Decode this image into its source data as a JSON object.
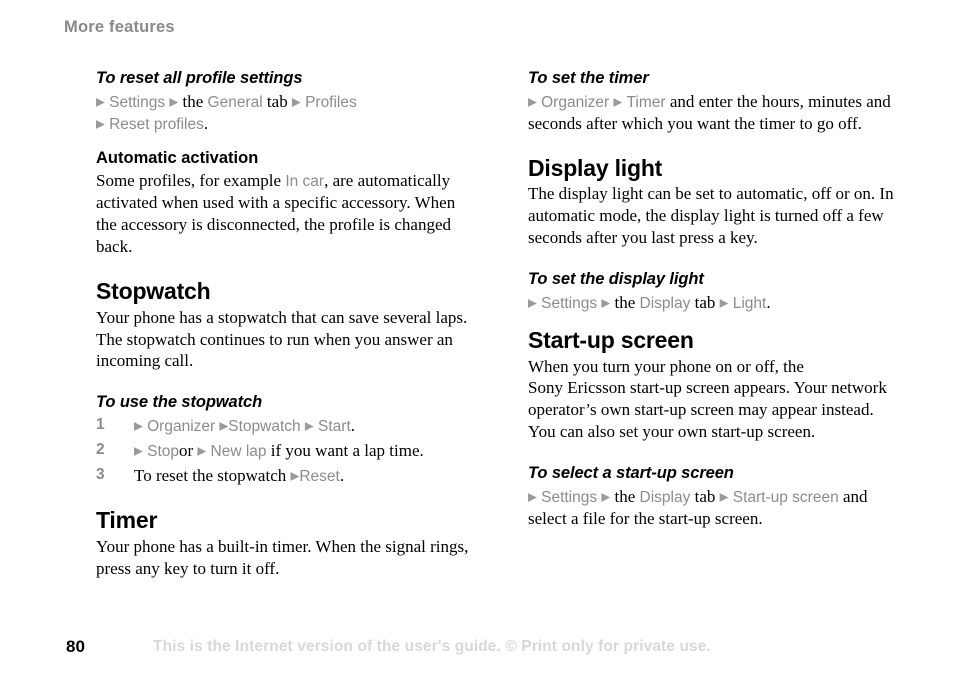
{
  "header": {
    "running_title": "More features"
  },
  "arrow_glyph": "▶",
  "colors": {
    "ui_term_gray": "#8c8c8c",
    "header_gray": "#8a8a8a",
    "watermark_gray": "#d8d8d8",
    "body_black": "#000000"
  },
  "left_column": {
    "proc_reset_profiles": {
      "title": "To reset all profile settings",
      "line1": {
        "term1": "Settings",
        "connector1": "the",
        "term2": "General",
        "connector2": "tab",
        "term3": "Profiles"
      },
      "line2": {
        "term1": "Reset profiles",
        "period": "."
      }
    },
    "automatic_activation": {
      "title": "Automatic activation",
      "text_before": "Some profiles, for example ",
      "ui_term": "In car",
      "text_after": ", are automatically activated when used with a specific accessory. When the accessory is disconnected, the profile is changed back."
    },
    "stopwatch": {
      "title": "Stopwatch",
      "body": "Your phone has a stopwatch that can save several laps. The stopwatch continues to run when you answer an incoming call."
    },
    "proc_use_stopwatch": {
      "title": "To use the stopwatch",
      "steps": [
        {
          "number": "1",
          "term1": "Organizer",
          "term2": "Stopwatch",
          "term3": "Start",
          "period": "."
        },
        {
          "number": "2",
          "term1": "Stop",
          "connector1": "or",
          "term2": "New lap",
          "tail": " if you want a lap time."
        },
        {
          "number": "3",
          "lead": "To reset the stopwatch ",
          "term1": "Reset",
          "period": "."
        }
      ]
    },
    "timer": {
      "title": "Timer",
      "body": "Your phone has a built-in timer. When the signal rings, press any key to turn it off."
    }
  },
  "right_column": {
    "proc_set_timer": {
      "title": "To set the timer",
      "term1": "Organizer",
      "term2": "Timer",
      "tail": " and enter the hours, minutes and seconds after which you want the timer to go off."
    },
    "display_light": {
      "title": "Display light",
      "body": "The display light can be set to automatic, off or on. In automatic mode, the display light is turned off a few seconds after you last press a key."
    },
    "proc_set_display_light": {
      "title": "To set the display light",
      "term1": "Settings",
      "connector1": "the",
      "term2": "Display",
      "connector2": "tab",
      "term3": "Light",
      "period": "."
    },
    "startup_screen": {
      "title": "Start-up screen",
      "body_line1": "When you turn your phone on or off, the",
      "body_line2": "Sony Ericsson start-up screen appears. Your network operator’s own start-up screen may appear instead. You can also set your own start-up screen."
    },
    "proc_select_startup_screen": {
      "title": "To select a start-up screen",
      "term1": "Settings",
      "connector1": "the",
      "term2": "Display",
      "connector2": "tab",
      "term3": "Start-up screen",
      "tail": " and select a file for the start-up screen."
    }
  },
  "footer": {
    "page_number": "80",
    "watermark": "This is the Internet version of the user's guide. © Print only for private use."
  }
}
